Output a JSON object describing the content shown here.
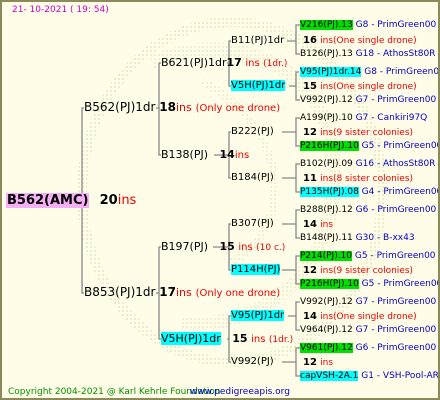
{
  "header": {
    "date": "21- 10-2021 ( 19: 54)"
  },
  "footer": {
    "copyright": "Copyright 2004-2021 @ Karl Kehrle Foundation",
    "url": "www.pedigreeapis.org"
  },
  "colors": {
    "root_bg": "#f5b0f5",
    "cyan_highlight": "#00ffff",
    "green_highlight": "#00e000",
    "ins_red": "#ee0000",
    "source_blue": "#0000cc",
    "line_gray": "#888888"
  },
  "tree": {
    "root": {
      "name": "B562(AMC)",
      "num": "20",
      "ins": "ins"
    },
    "sire": {
      "name": "B562(PJ)1dr",
      "num": "18",
      "ins": "ins",
      "note": "(Only one drone)"
    },
    "dam": {
      "name": "B853(PJ)1dr",
      "num": "17",
      "ins": "ins",
      "note": "(Only one drone)"
    },
    "sire_sire": {
      "name": "B621(PJ)1dr",
      "num": "17",
      "ins": "ins",
      "note": "(1dr.)"
    },
    "sire_dam": {
      "name": "B138(PJ)",
      "num": "14",
      "ins": "ins"
    },
    "dam_sire": {
      "name": "B197(PJ)",
      "num": "15",
      "ins": "ins",
      "note": "(10 c.)"
    },
    "dam_dam": {
      "name": "V5H(PJ)1dr",
      "num": "15",
      "ins": "ins",
      "note": "(1dr.)"
    },
    "g3": [
      {
        "name": "B11(PJ)1dr"
      },
      {
        "name": "V5H(PJ)1dr"
      },
      {
        "name": "B222(PJ)",
        "num": "12",
        "ins": "ins",
        "note": "(9 sister colonies)"
      },
      {
        "name": "B184(PJ)",
        "num": "11",
        "ins": "ins",
        "note": "(8 sister colonies)"
      },
      {
        "name": "B307(PJ)",
        "num": "14",
        "ins": "ins"
      },
      {
        "name": "P114H(PJ)",
        "num": "12",
        "ins": "ins",
        "note": "(9 sister colonies)"
      },
      {
        "name": "V95(PJ)1dr",
        "num": "14",
        "ins": "ins",
        "note": "(One single drone)"
      },
      {
        "name": "V992(PJ)",
        "num": "12",
        "ins": "ins"
      }
    ],
    "g3_extra": [
      {
        "num": "16",
        "ins": "ins",
        "note": "(One single drone)"
      },
      {
        "num": "15",
        "ins": "ins",
        "note": "(One single drone)"
      }
    ],
    "g4": [
      {
        "name": "V216(PJ).13",
        "src": "G8 - PrimGreen00"
      },
      {
        "name": "B126(PJ).13",
        "src": "G18 - AthosSt80R"
      },
      {
        "name": "V95(PJ)1dr.14",
        "src": "G8 - PrimGreen00"
      },
      {
        "name": "V992(PJ).12",
        "src": "G7 - PrimGreen00"
      },
      {
        "name": "A199(PJ).10",
        "src": "G7 - Cankiri97Q"
      },
      {
        "name": "P216H(PJ).10",
        "src": "G5 - PrimGreen00"
      },
      {
        "name": "B102(PJ).09",
        "src": "G16 - AthosSt80R"
      },
      {
        "name": "P135H(PJ).08",
        "src": "G4 - PrimGreen00"
      },
      {
        "name": "B288(PJ).12",
        "src": "G6 - PrimGreen00"
      },
      {
        "name": "B148(PJ).11",
        "src": "G30 - B-xx43"
      },
      {
        "name": "P214(PJ).10",
        "src": "G5 - PrimGreen00"
      },
      {
        "name": "P216H(PJ).10",
        "src": "G5 - PrimGreen00"
      },
      {
        "name": "V992(PJ).12",
        "src": "G7 - PrimGreen00"
      },
      {
        "name": "V964(PJ).12",
        "src": "G7 - PrimGreen00"
      },
      {
        "name": "V961(PJ).12",
        "src": "G6 - PrimGreen00"
      },
      {
        "name": "capVSH-2A.1",
        "src": "G1 - VSH-Pool-AR"
      }
    ]
  }
}
